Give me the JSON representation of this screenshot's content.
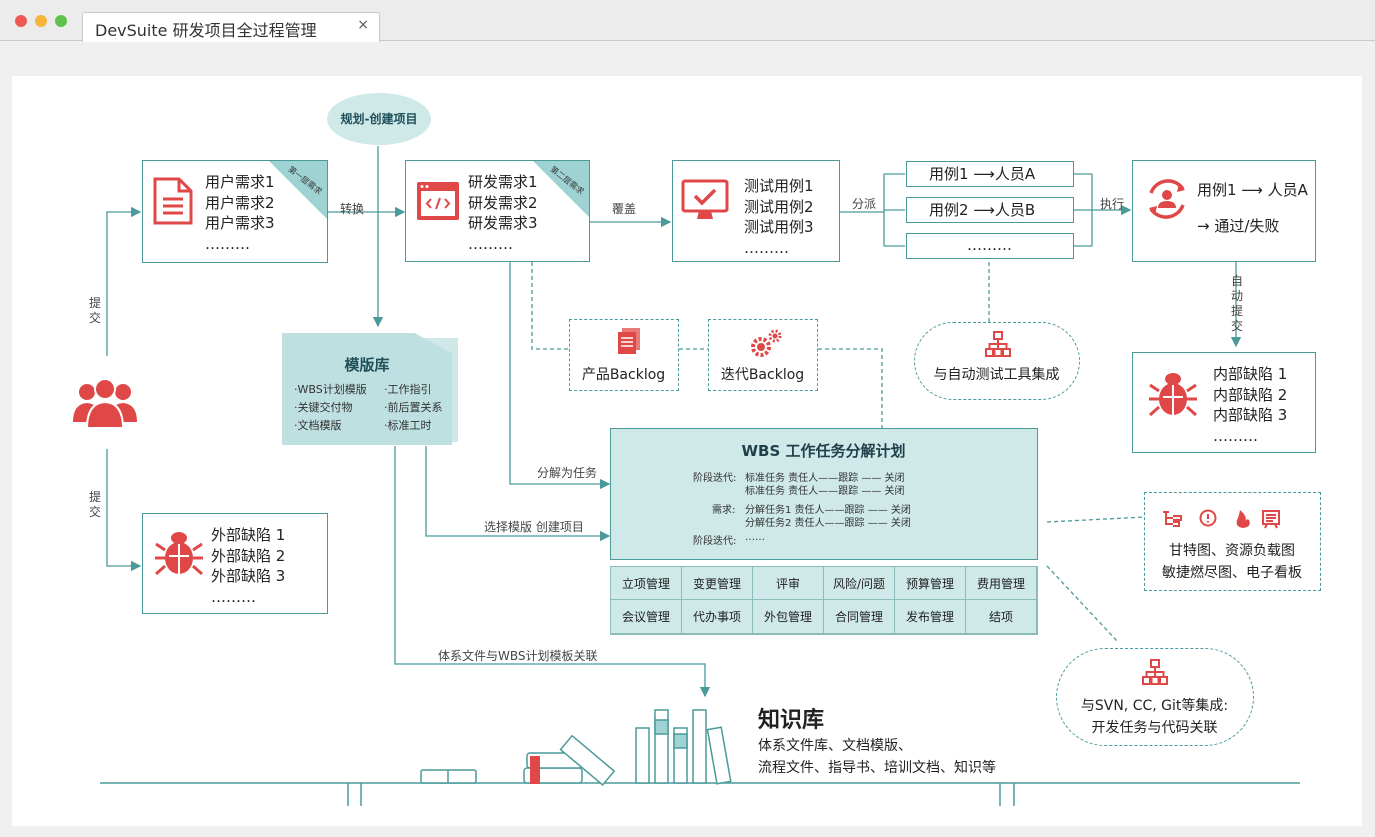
{
  "window": {
    "title": "DevSuite 研发项目全过程管理",
    "close": "×"
  },
  "plan": {
    "label": "规划-创建项目"
  },
  "user_req": {
    "lines": [
      "用户需求1",
      "用户需求2",
      "用户需求3",
      "………"
    ],
    "corner": "第一层需求"
  },
  "dev_req": {
    "lines": [
      "研发需求1",
      "研发需求2",
      "研发需求3",
      "………"
    ],
    "corner": "第二层需求"
  },
  "test_cases": {
    "lines": [
      "测试用例1",
      "测试用例2",
      "测试用例3",
      "………"
    ]
  },
  "assign": {
    "items": [
      "用例1 ⟶人员A",
      "用例2 ⟶人员B",
      "………"
    ]
  },
  "exec": {
    "line1": "用例1 ⟶ 人员A",
    "line2": "→ 通过/失败"
  },
  "internal_defects": {
    "lines": [
      "内部缺陷 1",
      "内部缺陷 2",
      "内部缺陷 3",
      "………"
    ]
  },
  "external_defects": {
    "lines": [
      "外部缺陷 1",
      "外部缺陷 2",
      "外部缺陷 3",
      "………"
    ]
  },
  "arrows": {
    "convert": "转换",
    "cover": "覆盖",
    "dispatch": "分派",
    "execute": "执行",
    "auto_submit": "自动提交",
    "submit_top": "提交",
    "submit_bottom": "提交",
    "decompose": "分解为任务",
    "select_tpl": "选择模版 创建项目",
    "kb_link": "体系文件与WBS计划模板关联"
  },
  "template_lib": {
    "title": "模版库",
    "items": [
      "·WBS计划模版",
      "·工作指引",
      "·关键交付物",
      "·前后置关系",
      "·文档模版",
      "·标准工时"
    ]
  },
  "product_backlog": "产品Backlog",
  "iter_backlog": "迭代Backlog",
  "auto_test": "与自动测试工具集成",
  "wbs": {
    "title": "WBS 工作任务分解计划",
    "rows": [
      {
        "label": "阶段迭代:",
        "text": "标准任务  责任人——跟踪 —— 关闭"
      },
      {
        "label": "",
        "text": "标准任务  责任人——跟踪 —— 关闭"
      },
      {
        "label": "需求:",
        "text": "分解任务1  责任人——跟踪 —— 关闭"
      },
      {
        "label": "",
        "text": "分解任务2  责任人——跟踪 —— 关闭"
      },
      {
        "label": "阶段迭代:",
        "text": "……"
      }
    ],
    "grid": [
      "立项管理",
      "变更管理",
      "评审",
      "风险/问题",
      "预算管理",
      "费用管理",
      "会议管理",
      "代办事项",
      "外包管理",
      "合同管理",
      "发布管理",
      "结项"
    ]
  },
  "reports": {
    "line1": "甘特图、资源负载图",
    "line2": "敏捷燃尽图、电子看板"
  },
  "scm": {
    "line1": "与SVN, CC, Git等集成:",
    "line2": "开发任务与代码关联"
  },
  "knowledge": {
    "title": "知识库",
    "line1": "体系文件库、文档模版、",
    "line2": "流程文件、指导书、培训文档、知识等"
  },
  "colors": {
    "teal": "#4a9a9a",
    "teal_light": "#cfe8e8",
    "red": "#e04848"
  }
}
